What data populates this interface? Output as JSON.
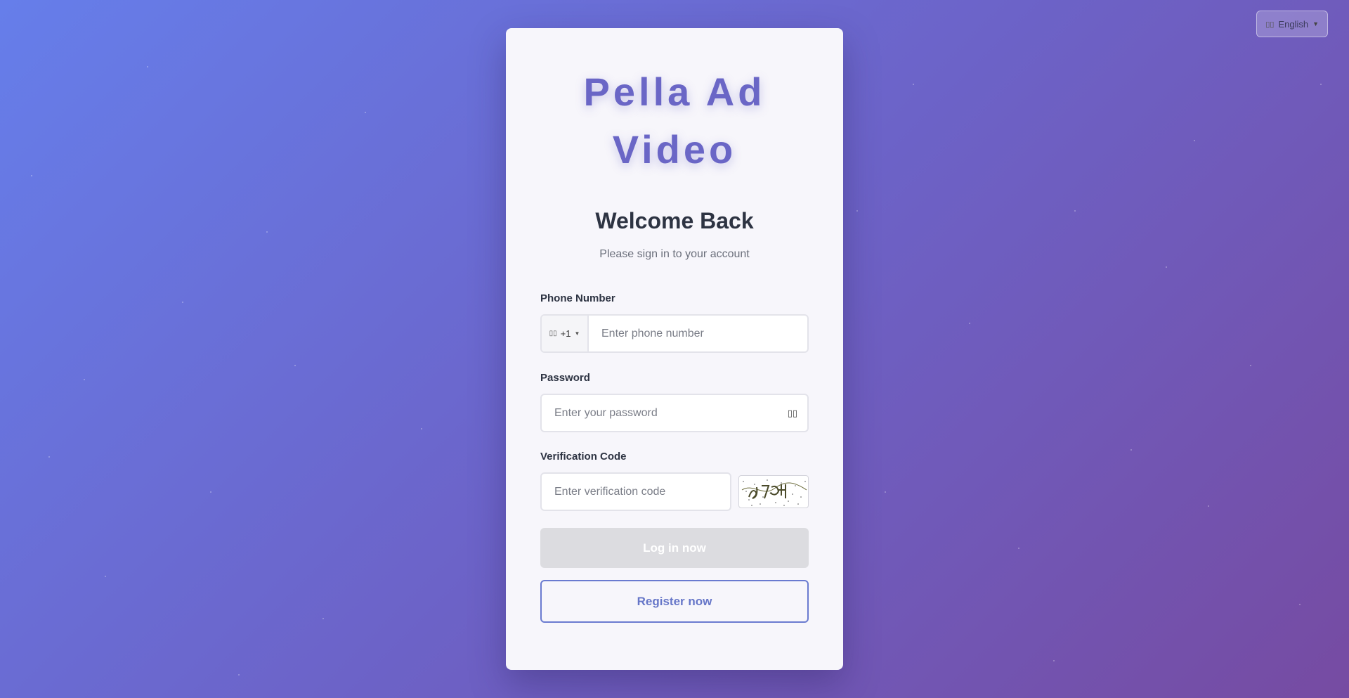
{
  "language": {
    "flag_icon": "flag-icon",
    "label": "English"
  },
  "brand": {
    "line1": "Pella Ad",
    "line2": "Video"
  },
  "heading": {
    "title": "Welcome Back",
    "subtitle": "Please sign in to your account"
  },
  "phone": {
    "label": "Phone Number",
    "country_code": "+1",
    "placeholder": "Enter phone number"
  },
  "password": {
    "label": "Password",
    "placeholder": "Enter your password"
  },
  "verification": {
    "label": "Verification Code",
    "placeholder": "Enter verification code"
  },
  "actions": {
    "login_label": "Log in now",
    "register_label": "Register now"
  },
  "colors": {
    "background_start": "#667eea",
    "background_end": "#764ba2",
    "brand": "#6a66c6",
    "login_disabled": "#dcdce0",
    "register_border": "#6a7bd0"
  }
}
